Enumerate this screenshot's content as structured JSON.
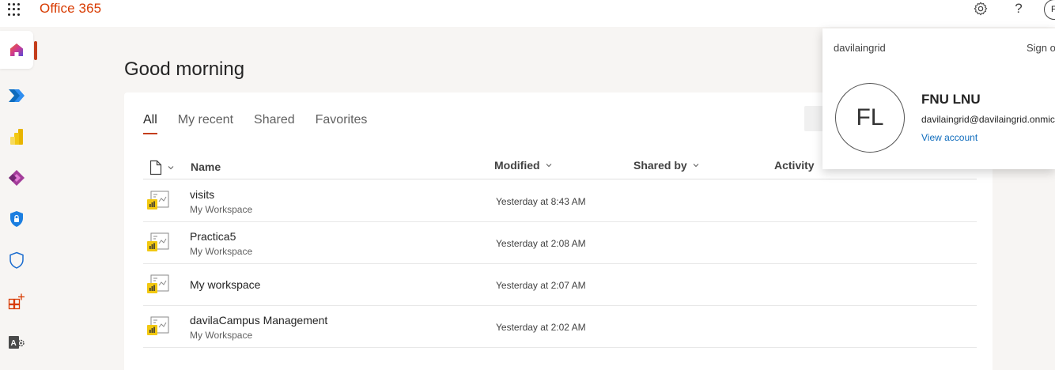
{
  "app": {
    "title": "Office 365"
  },
  "header": {
    "settings_icon": "gear-icon",
    "help_label": "?",
    "avatar_initial": "F"
  },
  "rail": {
    "items": [
      {
        "name": "home",
        "icon": "home-icon",
        "active": true
      },
      {
        "name": "power-automate",
        "icon": "power-automate-icon"
      },
      {
        "name": "power-bi",
        "icon": "power-bi-icon"
      },
      {
        "name": "power-apps",
        "icon": "power-apps-icon"
      },
      {
        "name": "security",
        "icon": "shield-lock-icon"
      },
      {
        "name": "defender",
        "icon": "shield-icon"
      },
      {
        "name": "apps",
        "icon": "apps-icon"
      },
      {
        "name": "admin",
        "icon": "admin-icon"
      }
    ],
    "accent": "#c43e1c"
  },
  "main": {
    "greeting": "Good morning",
    "tabs": [
      {
        "label": "All",
        "active": true
      },
      {
        "label": "My recent"
      },
      {
        "label": "Shared"
      },
      {
        "label": "Favorites"
      }
    ],
    "columns": {
      "name": "Name",
      "modified": "Modified",
      "shared_by": "Shared by",
      "activity": "Activity"
    },
    "files": [
      {
        "name": "visits",
        "location": "My Workspace",
        "modified": "Yesterday at 8:43 AM"
      },
      {
        "name": "Practica5",
        "location": "My Workspace",
        "modified": "Yesterday at 2:08 AM"
      },
      {
        "name": "My workspace",
        "location": "",
        "modified": "Yesterday at 2:07 AM"
      },
      {
        "name": "davilaCampus Management",
        "location": "My Workspace",
        "modified": "Yesterday at 2:02 AM"
      }
    ]
  },
  "account": {
    "org": "davilaingrid",
    "sign_out": "Sign out",
    "initials": "FL",
    "name": "FNU LNU",
    "email": "davilaingrid@davilaingrid.onmicrosoft.com",
    "view_account": "View account"
  },
  "colors": {
    "brand": "#d83b01",
    "accent": "#c43e1c",
    "link": "#0f6cbd",
    "powerbi": "#f2c811"
  }
}
